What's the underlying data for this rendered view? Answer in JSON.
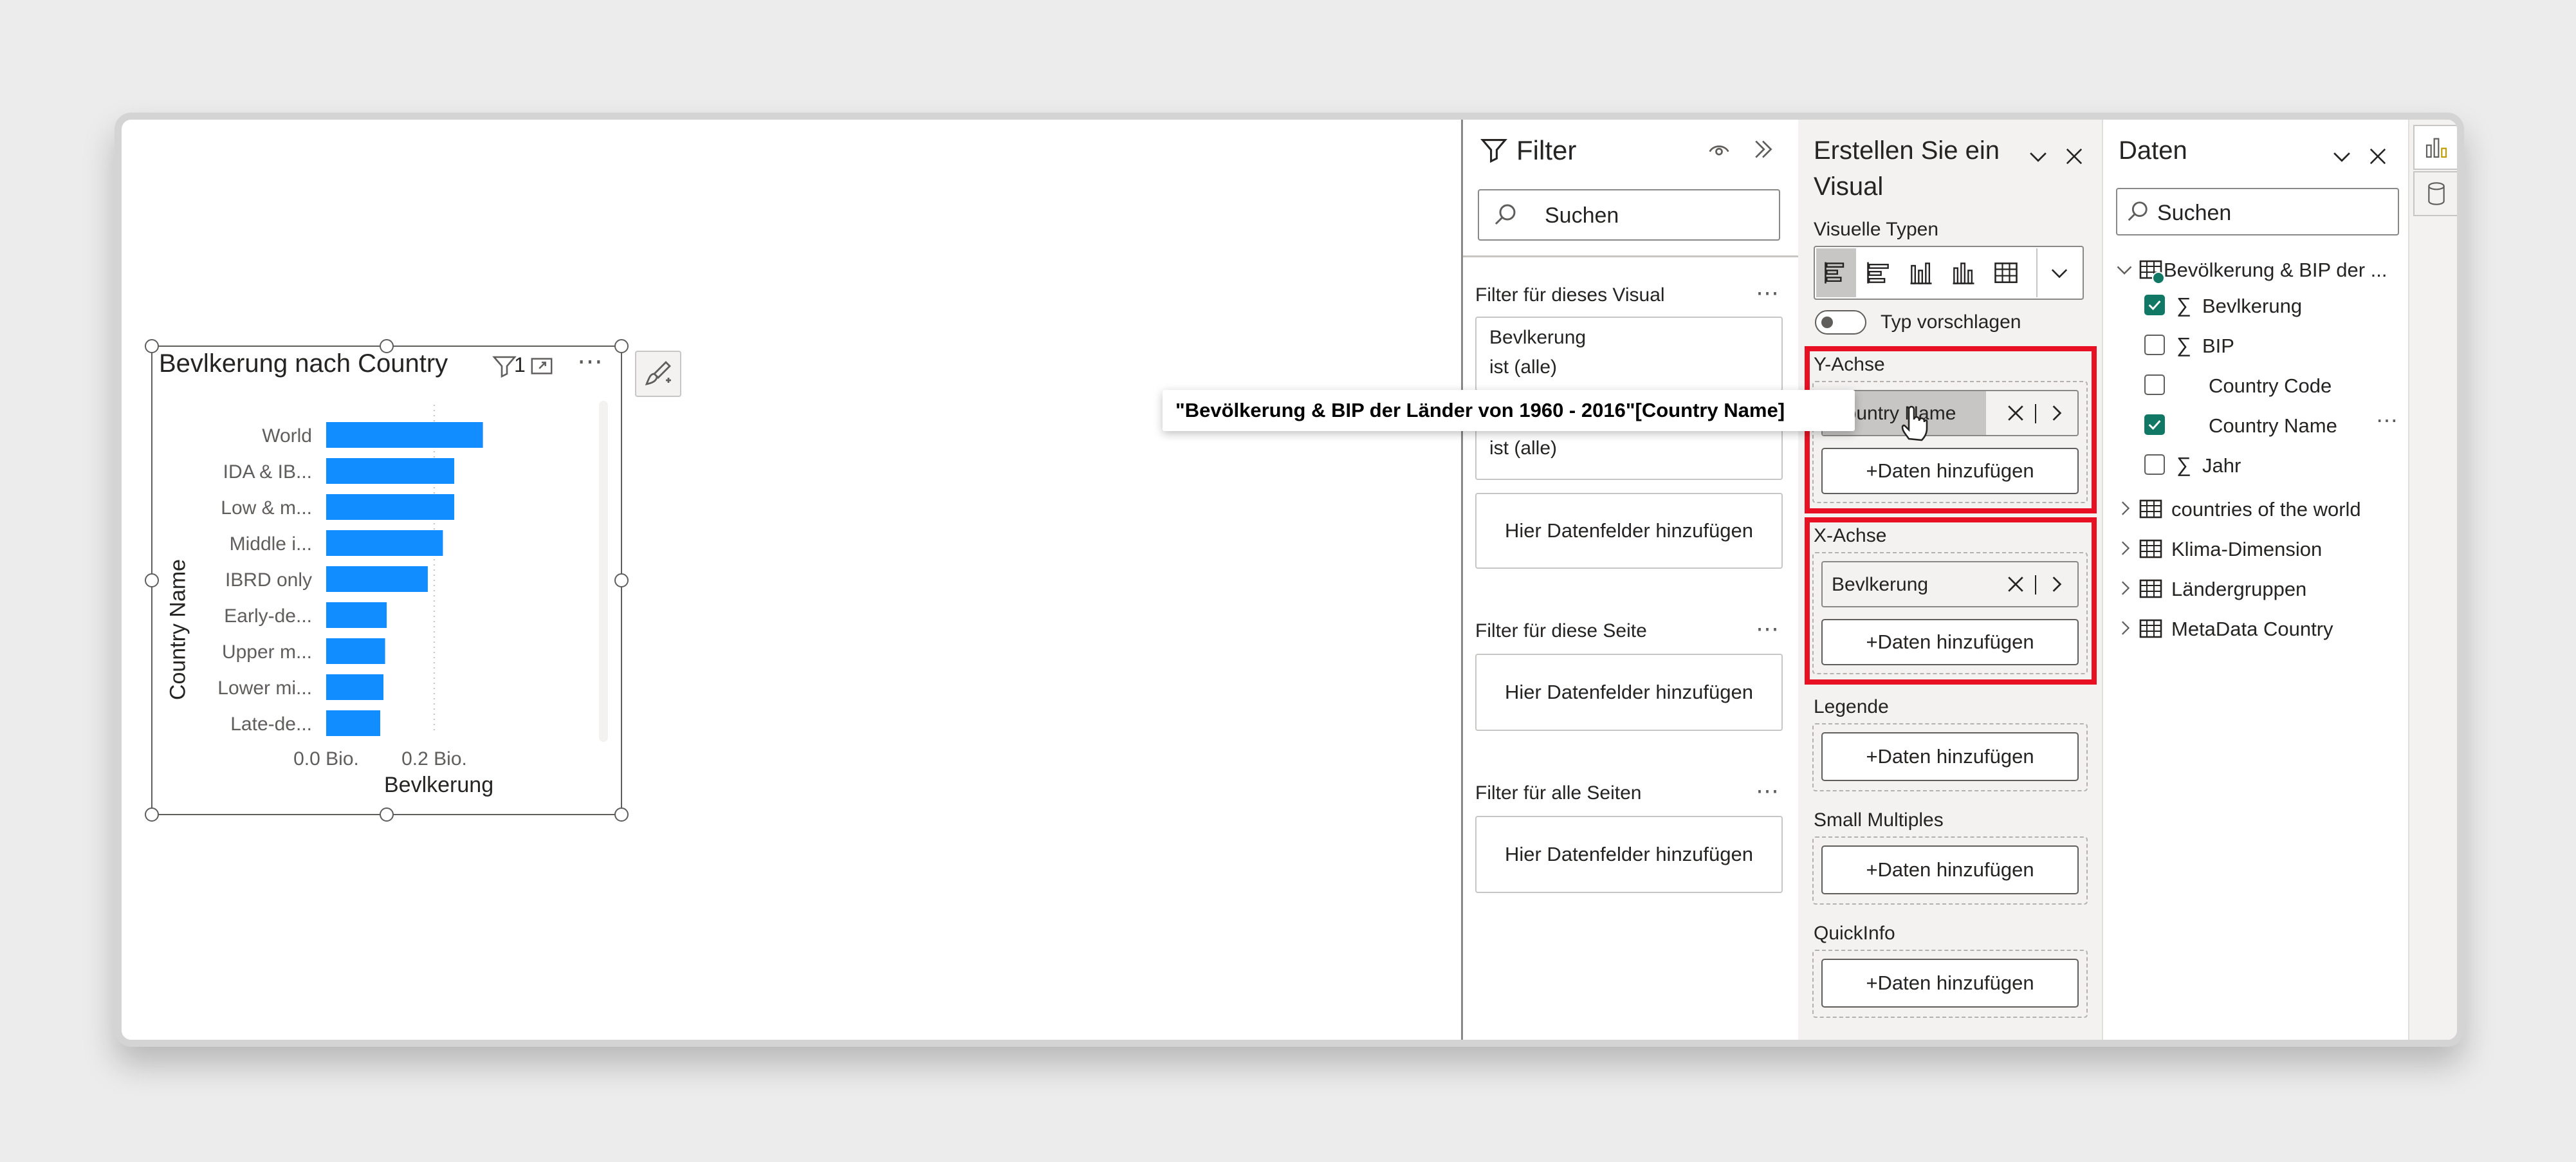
{
  "chart": {
    "title": "Bevlkerung nach Country",
    "filter_count": "1",
    "xlabel": "Bevlkerung",
    "ylabel": "Country Name",
    "ticks": [
      "0.0 Bio.",
      "0.2 Bio."
    ]
  },
  "chart_data": {
    "type": "bar",
    "orientation": "horizontal",
    "title": "Bevlkerung nach Country",
    "xlabel": "Bevlkerung",
    "ylabel": "Country Name",
    "categories": [
      "World",
      "IDA & IB...",
      "Low & m...",
      "Middle i...",
      "IBRD only",
      "Early-de...",
      "Upper m...",
      "Lower mi...",
      "Late-de..."
    ],
    "values": [
      0.29,
      0.237,
      0.237,
      0.216,
      0.188,
      0.112,
      0.109,
      0.106,
      0.1
    ],
    "xticks": [
      0.0,
      0.2
    ],
    "xunit": "Bio.",
    "xlim": [
      0,
      0.3
    ],
    "grid": true,
    "color": "#118DFF"
  },
  "tooltip": {
    "text": "\"Bevölkerung & BIP der Länder von 1960 - 2016\"[Country Name]"
  },
  "filter_pane": {
    "title": "Filter",
    "search_placeholder": "Suchen",
    "section_visual": "Filter für dieses Visual",
    "card1": {
      "field": "Bevlkerung",
      "value": "ist (alle)"
    },
    "card2": {
      "value": "ist (alle)"
    },
    "add_fields": "Hier Datenfelder hinzufügen",
    "section_page": "Filter für diese Seite",
    "section_all": "Filter für alle Seiten"
  },
  "viz_pane": {
    "title_line1": "Erstellen Sie ein",
    "title_line2": "Visual",
    "types_label": "Visuelle Typen",
    "suggest_label": "Typ vorschlagen",
    "y_axis": "Y-Achse",
    "y_field": "Country Name",
    "x_axis": "X-Achse",
    "x_field": "Bevlkerung",
    "add_data": "+Daten hinzufügen",
    "legend": "Legende",
    "small_multiples": "Small Multiples",
    "tooltip_well": "QuickInfo"
  },
  "data_pane": {
    "title": "Daten",
    "search_placeholder": "Suchen",
    "table1": "Bevölkerung & BIP der ...",
    "fields": [
      {
        "label": "Bevlkerung",
        "sigma": true,
        "checked": true
      },
      {
        "label": "BIP",
        "sigma": true,
        "checked": false
      },
      {
        "label": "Country Code",
        "sigma": false,
        "checked": false
      },
      {
        "label": "Country Name",
        "sigma": false,
        "checked": true
      },
      {
        "label": "Jahr",
        "sigma": true,
        "checked": false
      }
    ],
    "tables": [
      "countries of the world",
      "Klima-Dimension",
      "Ländergruppen",
      "MetaData Country"
    ]
  },
  "colors": {
    "bar": "#118DFF",
    "accent": "#117865",
    "highlight": "#E81123"
  }
}
